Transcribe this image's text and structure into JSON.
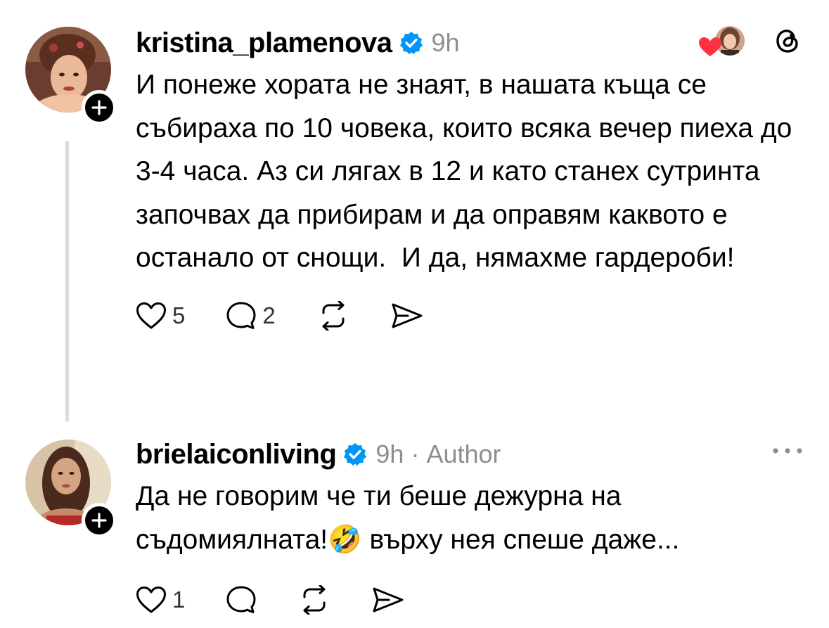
{
  "posts": [
    {
      "username": "kristina_plamenova",
      "timestamp": "9h",
      "text": "И понеже хората не знаят, в нашата къща се събираха по 10 човека, които всяка вечер пиеха до 3-4 часа. Аз си лягах в 12 и като станех сутринта започвах да прибирам и да оправям каквото е останало от снощи.  И да, нямахме гардероби!",
      "likes": "5",
      "replies": "2",
      "icons": {
        "like": "heart-outline-icon",
        "reply": "speech-bubble-icon",
        "repost": "repost-arrows-icon",
        "share": "paper-plane-icon",
        "liked_by": "red-heart-icon",
        "platform": "threads-logo-icon"
      }
    },
    {
      "username": "brielaiconliving",
      "timestamp": "9h",
      "separator": "·",
      "author_label": "Author",
      "text_part1": "Да не говорим че ти беше дежурна на съдомиялната!",
      "emoji": "🤣",
      "text_part2": " върху нея спеше даже...",
      "likes": "1",
      "icons": {
        "more": "more-dots-icon"
      }
    }
  ],
  "colors": {
    "verified_blue": "#0095f6",
    "heart_red": "#ff3040",
    "muted_gray": "#8e8e8e",
    "thread_line": "#dcdcdc"
  }
}
